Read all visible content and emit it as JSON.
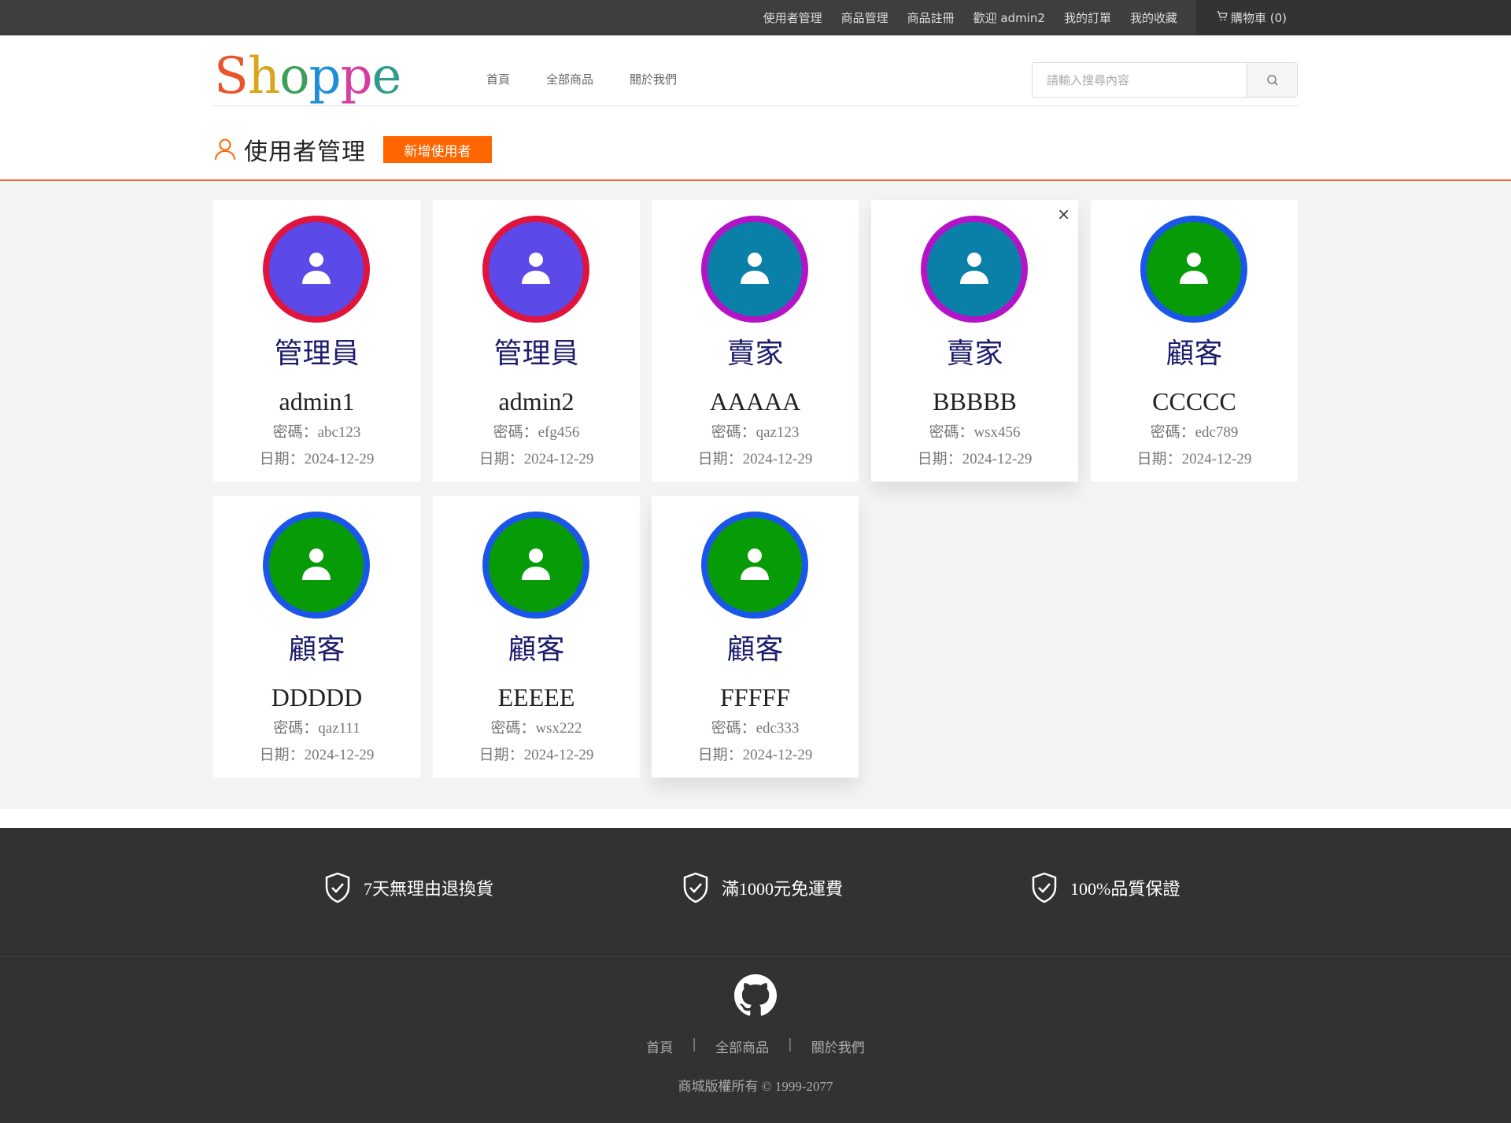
{
  "topbar": {
    "links": [
      "使用者管理",
      "商品管理",
      "商品註冊",
      "歡迎 admin2",
      "我的訂單",
      "我的收藏"
    ],
    "cart_label": "購物車 (0)"
  },
  "header": {
    "logo_letters": [
      "S",
      "h",
      "o",
      "p",
      "p",
      "e"
    ],
    "logo_colors": [
      "#e8552b",
      "#d9a51a",
      "#3d9e5a",
      "#1d8fd8",
      "#d43fa1",
      "#2c9c8c"
    ],
    "nav": [
      "首頁",
      "全部商品",
      "關於我們"
    ],
    "search_placeholder": "請輸入搜尋內容"
  },
  "page": {
    "title": "使用者管理",
    "add_button": "新增使用者"
  },
  "users": [
    {
      "role": "管理員",
      "name": "admin1",
      "password": "密碼：abc123",
      "date": "日期：2024-12-29",
      "ring": "#e0143c",
      "fill": "#5b49e8"
    },
    {
      "role": "管理員",
      "name": "admin2",
      "password": "密碼：efg456",
      "date": "日期：2024-12-29",
      "ring": "#e0143c",
      "fill": "#5b49e8"
    },
    {
      "role": "賣家",
      "name": "AAAAA",
      "password": "密碼：qaz123",
      "date": "日期：2024-12-29",
      "ring": "#b414c8",
      "fill": "#0a80a8"
    },
    {
      "role": "賣家",
      "name": "BBBBB",
      "password": "密碼：wsx456",
      "date": "日期：2024-12-29",
      "ring": "#b414c8",
      "fill": "#0a80a8"
    },
    {
      "role": "顧客",
      "name": "CCCCC",
      "password": "密碼：edc789",
      "date": "日期：2024-12-29",
      "ring": "#1a56e8",
      "fill": "#079c07"
    },
    {
      "role": "顧客",
      "name": "DDDDD",
      "password": "密碼：qaz111",
      "date": "日期：2024-12-29",
      "ring": "#1a56e8",
      "fill": "#079c07"
    },
    {
      "role": "顧客",
      "name": "EEEEE",
      "password": "密碼：wsx222",
      "date": "日期：2024-12-29",
      "ring": "#1a56e8",
      "fill": "#079c07"
    },
    {
      "role": "顧客",
      "name": "FFFFF",
      "password": "密碼：edc333",
      "date": "日期：2024-12-29",
      "ring": "#1a56e8",
      "fill": "#079c07"
    }
  ],
  "card_close": "×",
  "footer": {
    "promos": [
      "7天無理由退換貨",
      "滿1000元免運費",
      "100%品質保證"
    ],
    "nav": [
      "首頁",
      "全部商品",
      "關於我們"
    ],
    "separator": "|",
    "copyright": "商城版權所有 © 1999-2077"
  },
  "colors": {
    "accent": "#ff6600",
    "topbar": "#3e3e3e",
    "footer": "#323232"
  }
}
